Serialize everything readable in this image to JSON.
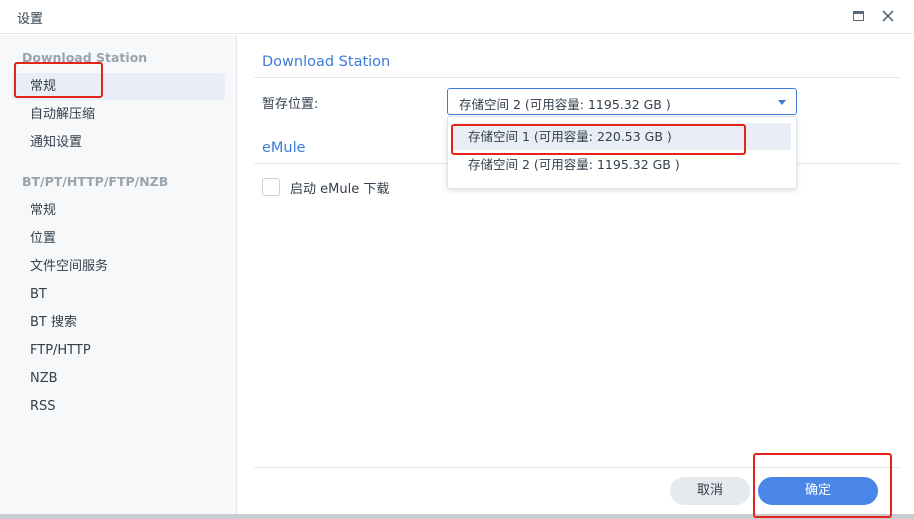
{
  "window": {
    "title": "设置"
  },
  "sidebar": {
    "groups": [
      {
        "title": "Download Station",
        "items": [
          {
            "label": "常规",
            "active": true
          },
          {
            "label": "自动解压缩",
            "active": false
          },
          {
            "label": "通知设置",
            "active": false
          }
        ]
      },
      {
        "title": "BT/PT/HTTP/FTP/NZB",
        "items": [
          {
            "label": "常规",
            "active": false
          },
          {
            "label": "位置",
            "active": false
          },
          {
            "label": "文件空间服务",
            "active": false
          },
          {
            "label": "BT",
            "active": false
          },
          {
            "label": "BT 搜索",
            "active": false
          },
          {
            "label": "FTP/HTTP",
            "active": false
          },
          {
            "label": "NZB",
            "active": false
          },
          {
            "label": "RSS",
            "active": false
          }
        ]
      }
    ]
  },
  "main": {
    "section_download": {
      "title": "Download Station",
      "temp_location_label": "暂存位置:",
      "temp_location_selected": "存储空间 2 (可用容量:  1195.32 GB )",
      "temp_location_options": [
        "存储空间 1 (可用容量:  220.53 GB )",
        "存储空间 2 (可用容量:  1195.32 GB )"
      ]
    },
    "section_emule": {
      "title": "eMule",
      "enable_label": "启动 eMule 下载",
      "enabled": false
    }
  },
  "footer": {
    "cancel_label": "取消",
    "ok_label": "确定"
  },
  "colors": {
    "accent": "#3d7bd6",
    "primary_button": "#4a86e8",
    "annotation": "#e3241b"
  }
}
